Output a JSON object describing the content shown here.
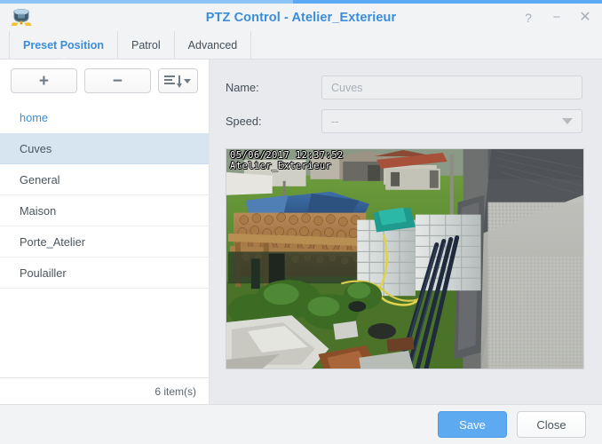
{
  "window": {
    "title": "PTZ Control - Atelier_Exterieur",
    "app_icon": "dome-camera-icon",
    "controls": [
      {
        "name": "help",
        "glyph": "?"
      },
      {
        "name": "minimize",
        "glyph": "−"
      },
      {
        "name": "close",
        "glyph": "✕"
      }
    ],
    "accent_color": "#59a9f5"
  },
  "tabs": [
    {
      "label": "Preset Position",
      "active": true
    },
    {
      "label": "Patrol",
      "active": false
    },
    {
      "label": "Advanced",
      "active": false
    }
  ],
  "toolbar": {
    "add_label": "+",
    "remove_label": "−",
    "sort_icon": "sort-descending-icon",
    "sort_caret": "chevron-down-icon"
  },
  "preset_list": {
    "items": [
      {
        "label": "home",
        "style": "link",
        "selected": false
      },
      {
        "label": "Cuves",
        "style": "normal",
        "selected": true
      },
      {
        "label": "General",
        "style": "normal",
        "selected": false
      },
      {
        "label": "Maison",
        "style": "normal",
        "selected": false
      },
      {
        "label": "Porte_Atelier",
        "style": "normal",
        "selected": false
      },
      {
        "label": "Poulailler",
        "style": "normal",
        "selected": false
      }
    ],
    "footer_count": "6 item(s)",
    "selected_color": "#d6e5f0"
  },
  "form": {
    "name_label": "Name:",
    "name_value": "Cuves",
    "speed_label": "Speed:",
    "speed_value": "--"
  },
  "camera": {
    "osd_timestamp": "05/06/2017 12:37:52",
    "osd_name": "Atelier_Exterieur",
    "scene_description": "Outdoor yard with stacked firewood under blue tarp, white IBC water tanks, grass lawn, concrete wall and outbuildings"
  },
  "footer": {
    "save_label": "Save",
    "close_label": "Close",
    "primary_color": "#5eaaf0"
  }
}
